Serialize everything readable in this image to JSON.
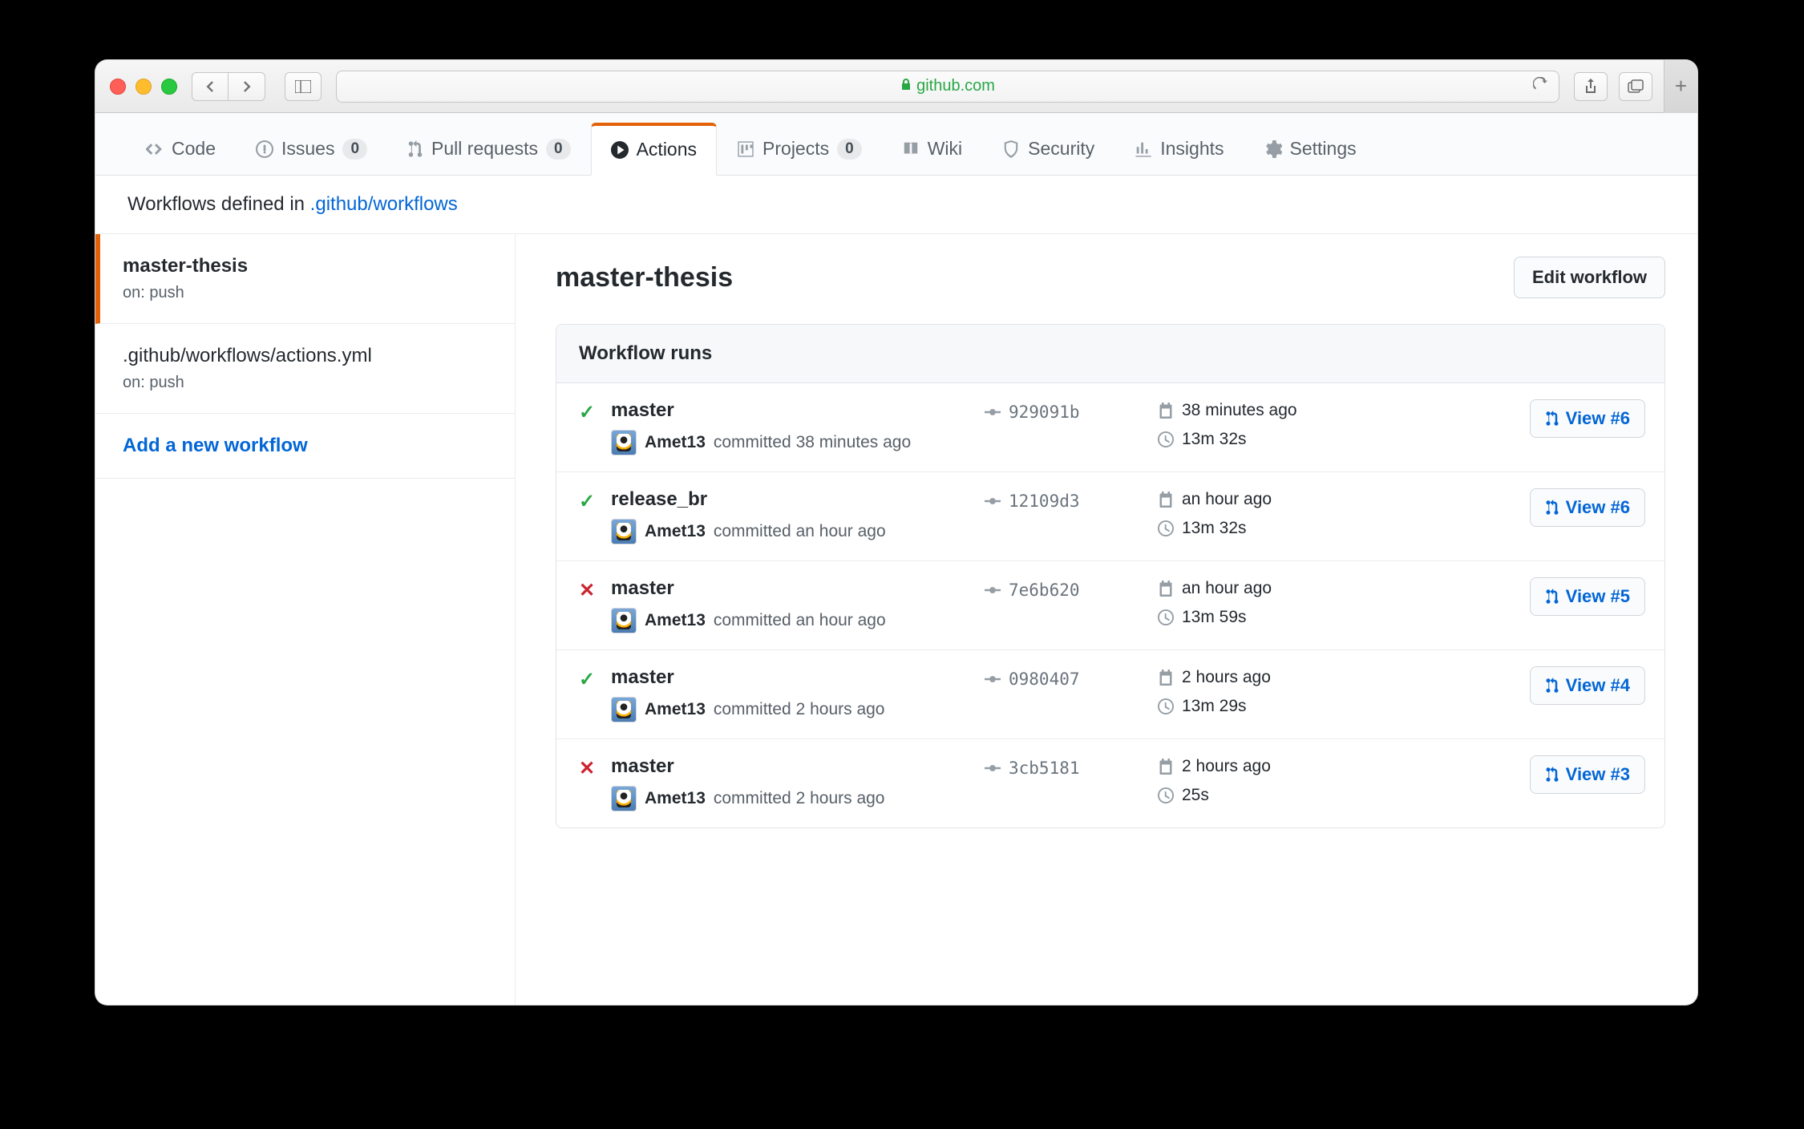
{
  "browser": {
    "host": "github.com"
  },
  "tabs": {
    "code": "Code",
    "issues": "Issues",
    "issues_count": "0",
    "pulls": "Pull requests",
    "pulls_count": "0",
    "actions": "Actions",
    "projects": "Projects",
    "projects_count": "0",
    "wiki": "Wiki",
    "security": "Security",
    "insights": "Insights",
    "settings": "Settings"
  },
  "subheader": {
    "prefix": "Workflows defined in ",
    "link": ".github/workflows"
  },
  "sidebar": {
    "items": [
      {
        "name": "master-thesis",
        "sub": "on: push",
        "selected": true
      },
      {
        "name": ".github/workflows/actions.yml",
        "sub": "on: push",
        "selected": false
      }
    ],
    "add": "Add a new workflow"
  },
  "content": {
    "title": "master-thesis",
    "edit_btn": "Edit workflow",
    "runs_header": "Workflow runs"
  },
  "runs": [
    {
      "status": "success",
      "branch": "master",
      "author": "Amet13",
      "committed": "committed 38 minutes ago",
      "commit": "929091b",
      "time": "38 minutes ago",
      "duration": "13m 32s",
      "view": "View #6"
    },
    {
      "status": "success",
      "branch": "release_br",
      "author": "Amet13",
      "committed": "committed an hour ago",
      "commit": "12109d3",
      "time": "an hour ago",
      "duration": "13m 32s",
      "view": "View #6"
    },
    {
      "status": "fail",
      "branch": "master",
      "author": "Amet13",
      "committed": "committed an hour ago",
      "commit": "7e6b620",
      "time": "an hour ago",
      "duration": "13m 59s",
      "view": "View #5"
    },
    {
      "status": "success",
      "branch": "master",
      "author": "Amet13",
      "committed": "committed 2 hours ago",
      "commit": "0980407",
      "time": "2 hours ago",
      "duration": "13m 29s",
      "view": "View #4"
    },
    {
      "status": "fail",
      "branch": "master",
      "author": "Amet13",
      "committed": "committed 2 hours ago",
      "commit": "3cb5181",
      "time": "2 hours ago",
      "duration": "25s",
      "view": "View #3"
    }
  ]
}
